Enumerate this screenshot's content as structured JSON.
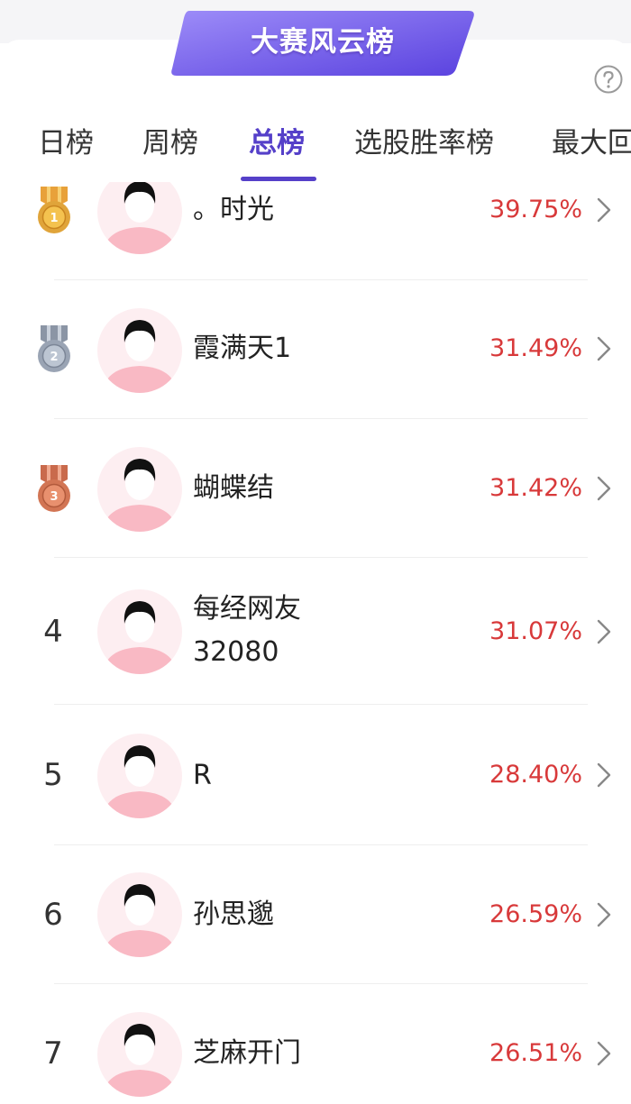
{
  "banner": {
    "title": "大赛风云榜"
  },
  "tabs": [
    {
      "label": "日榜",
      "active": false
    },
    {
      "label": "周榜",
      "active": false
    },
    {
      "label": "总榜",
      "active": true
    },
    {
      "label": "选股胜率榜",
      "active": false
    },
    {
      "label": "最大回",
      "active": false
    }
  ],
  "list": [
    {
      "rank": "1",
      "medal": "gold-medal-icon",
      "name": "。时光",
      "name_line2": "",
      "pct": "39.75%"
    },
    {
      "rank": "2",
      "medal": "silver-medal-icon",
      "name": "霞满天1",
      "name_line2": "",
      "pct": "31.49%"
    },
    {
      "rank": "3",
      "medal": "bronze-medal-icon",
      "name": "蝴蝶结",
      "name_line2": "",
      "pct": "31.42%"
    },
    {
      "rank": "4",
      "medal": "",
      "name": "每经网友",
      "name_line2": "32080",
      "pct": "31.07%"
    },
    {
      "rank": "5",
      "medal": "",
      "name": "R",
      "name_line2": "",
      "pct": "28.40%"
    },
    {
      "rank": "6",
      "medal": "",
      "name": "孙思邈",
      "name_line2": "",
      "pct": "26.59%"
    },
    {
      "rank": "7",
      "medal": "",
      "name": "芝麻开门",
      "name_line2": "",
      "pct": "26.51%"
    }
  ],
  "colors": {
    "accent": "#5540c9",
    "banner_gradient_start": "#8f7cf6",
    "banner_gradient_end": "#5b43e0",
    "percent_red": "#d8393a",
    "gold": "#e0a43a",
    "silver": "#9aa4b4",
    "bronze": "#d27554",
    "avatar_bg": "#fde6ea"
  },
  "icons": {
    "help": "question-circle-icon",
    "row_arrow": "chevron-right-icon",
    "avatar": "default-avatar-icon"
  }
}
